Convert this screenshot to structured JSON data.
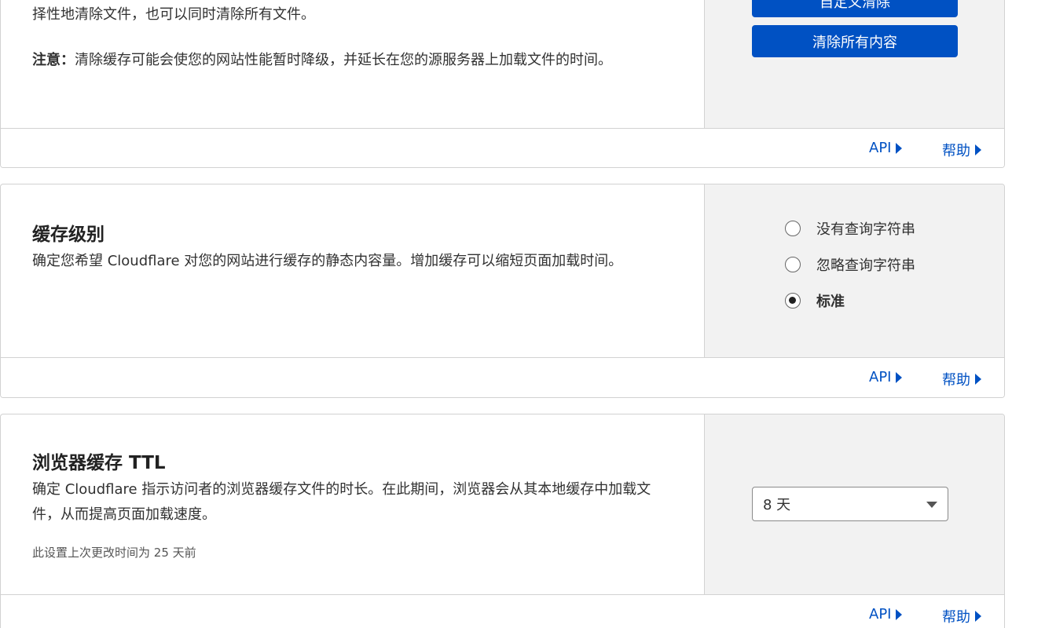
{
  "purge_card": {
    "desc_line": "择性地清除文件，也可以同时清除所有文件。",
    "note_label": "注意：",
    "note_text": "清除缓存可能会使您的网站性能暂时降级，并延长在您的源服务器上加载文件的时间。",
    "custom_purge_button": "自定义清除",
    "purge_all_button": "清除所有内容",
    "api_link": "API",
    "help_link": "帮助"
  },
  "cache_level_card": {
    "title": "缓存级别",
    "description": "确定您希望 Cloudflare 对您的网站进行缓存的静态内容量。增加缓存可以缩短页面加载时间。",
    "options": [
      {
        "label": "没有查询字符串",
        "checked": false
      },
      {
        "label": "忽略查询字符串",
        "checked": false
      },
      {
        "label": "标准",
        "checked": true
      }
    ],
    "api_link": "API",
    "help_link": "帮助"
  },
  "browser_ttl_card": {
    "title": "浏览器缓存 TTL",
    "description": "确定 Cloudflare 指示访问者的浏览器缓存文件的时长。在此期间，浏览器会从其本地缓存中加载文件，从而提高页面加载速度。",
    "last_modified": "此设置上次更改时间为 25 天前",
    "selected_value": "8 天",
    "api_link": "API",
    "help_link": "帮助"
  }
}
